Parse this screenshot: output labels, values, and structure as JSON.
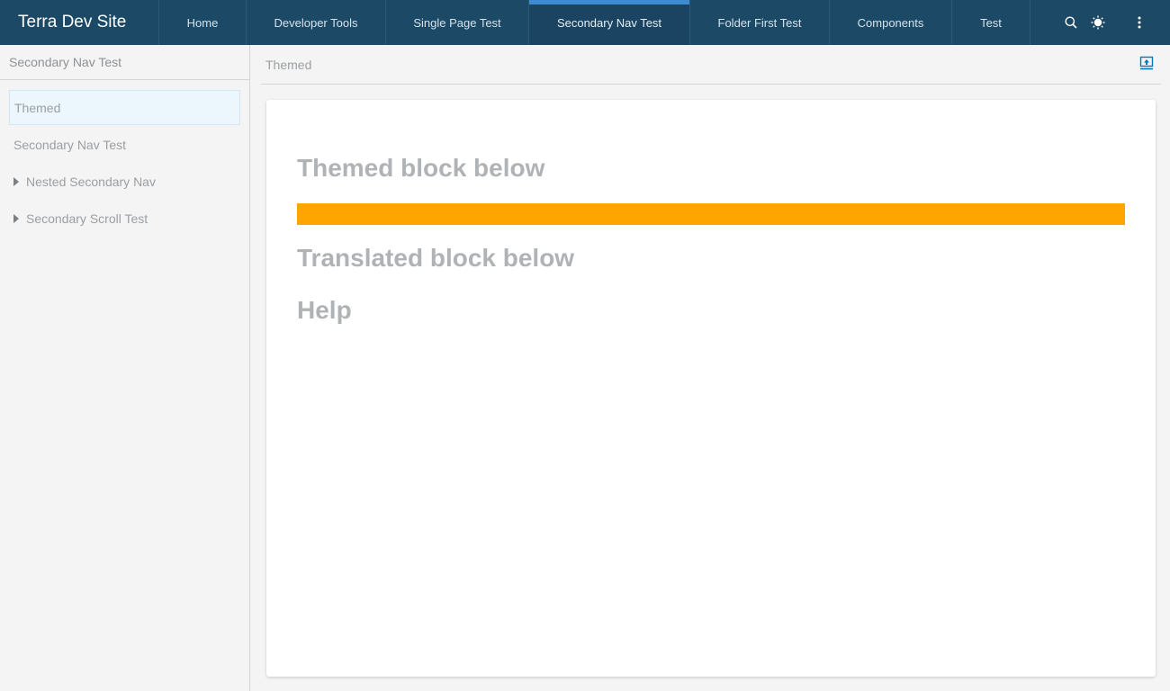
{
  "header": {
    "brand": "Terra Dev Site",
    "nav": [
      {
        "label": "Home",
        "active": false
      },
      {
        "label": "Developer Tools",
        "active": false
      },
      {
        "label": "Single Page Test",
        "active": false
      },
      {
        "label": "Secondary Nav Test",
        "active": true
      },
      {
        "label": "Folder First Test",
        "active": false
      },
      {
        "label": "Components",
        "active": false
      },
      {
        "label": "Test",
        "active": false
      }
    ],
    "tools": [
      "search-icon",
      "theme-toggle-icon",
      "more-options-icon"
    ]
  },
  "sidebar": {
    "title": "Secondary Nav Test",
    "items": [
      {
        "label": "Themed",
        "selected": true,
        "expandable": false
      },
      {
        "label": "Secondary Nav Test",
        "selected": false,
        "expandable": false
      },
      {
        "label": "Nested Secondary Nav",
        "selected": false,
        "expandable": true
      },
      {
        "label": "Secondary Scroll Test",
        "selected": false,
        "expandable": true
      }
    ]
  },
  "main": {
    "page_title": "Themed",
    "headings": {
      "themed": "Themed block below",
      "translated": "Translated block below",
      "help": "Help"
    },
    "themed_block_color": "#ffa500"
  },
  "colors": {
    "header_bg": "#1c4966",
    "active_indicator": "#3d8bd0",
    "selected_item_bg": "#ebf6fd",
    "icon_accent": "#0079be"
  }
}
